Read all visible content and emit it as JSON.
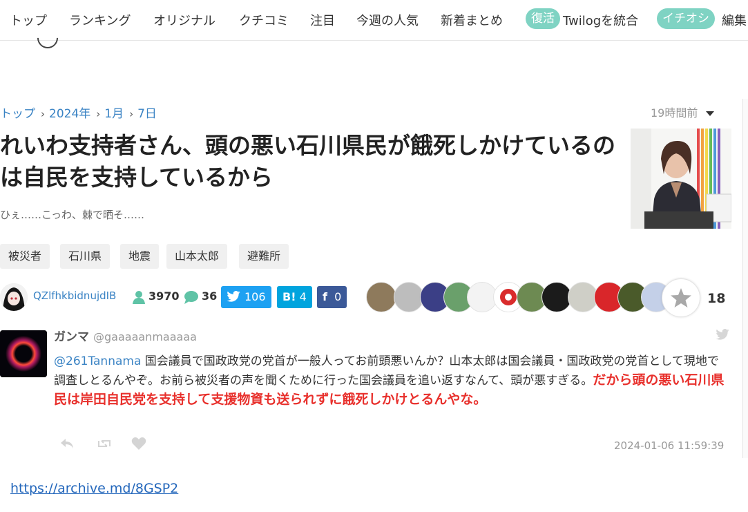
{
  "nav": {
    "items": [
      "トップ",
      "ランキング",
      "オリジナル",
      "クチコミ",
      "注目",
      "今週の人気",
      "新着まとめ"
    ],
    "badge1": "復活",
    "badge1_text": "Twilogを統合",
    "badge2": "イチオシ",
    "badge2_text": "編集"
  },
  "breadcrumb": {
    "items": [
      "トップ",
      "2024年",
      "1月",
      "7日"
    ]
  },
  "time_ago": "19時間前",
  "article": {
    "title": "れいわ支持者さん、頭の悪い石川県民が餓死しかけているのは自民を支持しているから",
    "subtitle": "ひぇ……こっわ、棘で晒そ……"
  },
  "tags": [
    "被災者",
    "石川県",
    "地震",
    "山本太郎",
    "避難所"
  ],
  "meta": {
    "author": "QZlfhkbidnujdIB",
    "views": "3970",
    "comments": "36",
    "twitter_count": "106",
    "hatena_label": "B!",
    "hatena_count": "4",
    "facebook_count": "0",
    "favorite_count": "18"
  },
  "tweet": {
    "name": "ガンマ",
    "handle": "@gaaaaanmaaaaa",
    "mention": "@261Tannama",
    "text_plain": " 国会議員で国政政党の党首が一般人ってお前頭悪いんか？山本太郎は国会議員・国政政党の党首として現地で調査しとるんやぞ。お前ら被災者の声を聞くために行った国会議員を追い返すなんて、頭が悪すぎる。",
    "text_emphasis": "だから頭の悪い石川県民は岸田自民党を支持して支援物資も送られずに餓死しかけとるんやな。",
    "date": "2024-01-06 11:59:39"
  },
  "archive_link": "https://archive.md/8GSP2",
  "colors": {
    "link": "#3a83c4",
    "badge": "#7fd3c3",
    "twitter": "#1da1f2",
    "hatena": "#00a4de",
    "facebook": "#3b5998",
    "emphasis": "#e8302c"
  }
}
